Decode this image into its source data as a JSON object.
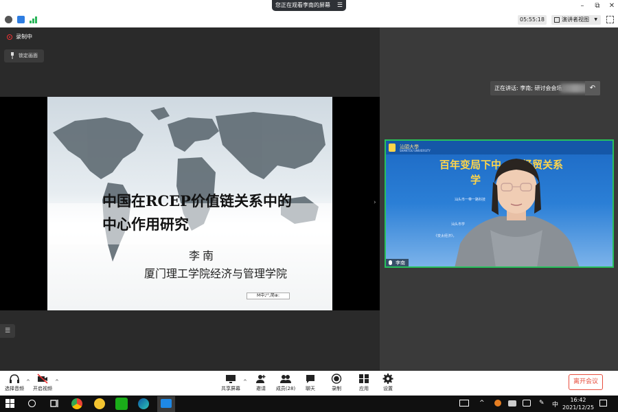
{
  "meeting": {
    "sharing_notice": "您正在观看李南的屏幕",
    "timer": "05:55:18",
    "speaker_view": "演讲者视图",
    "recording": "录制中",
    "lock_screen": "锁定画面",
    "speaking_now": "正在讲话: 李南; 研讨会会场;"
  },
  "slide": {
    "title_line1": "中国在RCEP价值链关系中的",
    "title_line2": "中心作用研究",
    "author": "李南",
    "affiliation": "厦门理工学院经济与管理学院",
    "ime_bar": "M中♪°,简⊕:"
  },
  "video": {
    "participant_name": "李南",
    "banner_university": "汕頭大學",
    "banner_university_en": "SHANTOU UNIVERSITY",
    "banner_title_line1": "百年变局下中　　经贸关系",
    "banner_title_line2": "学",
    "banner_line_a": "汕头市一带一路科技",
    "banner_line_b": "汕头市学",
    "banner_line_c": "《变太经济》，"
  },
  "toolbar": {
    "audio": "选择音频",
    "video": "开启视频",
    "share": "共享屏幕",
    "invite": "邀请",
    "members": "成员(28)",
    "chat": "聊天",
    "record": "录制",
    "apps": "应用",
    "settings": "设置",
    "leave": "离开会议"
  },
  "taskbar": {
    "time": "16:42",
    "date": "2021/12/25",
    "ime": "中"
  },
  "colors": {
    "active_speaker_border": "#27c15c",
    "leave_red": "#e74c3c",
    "banner_blue": "#1c69c4",
    "banner_yellow": "#ffd54a"
  }
}
